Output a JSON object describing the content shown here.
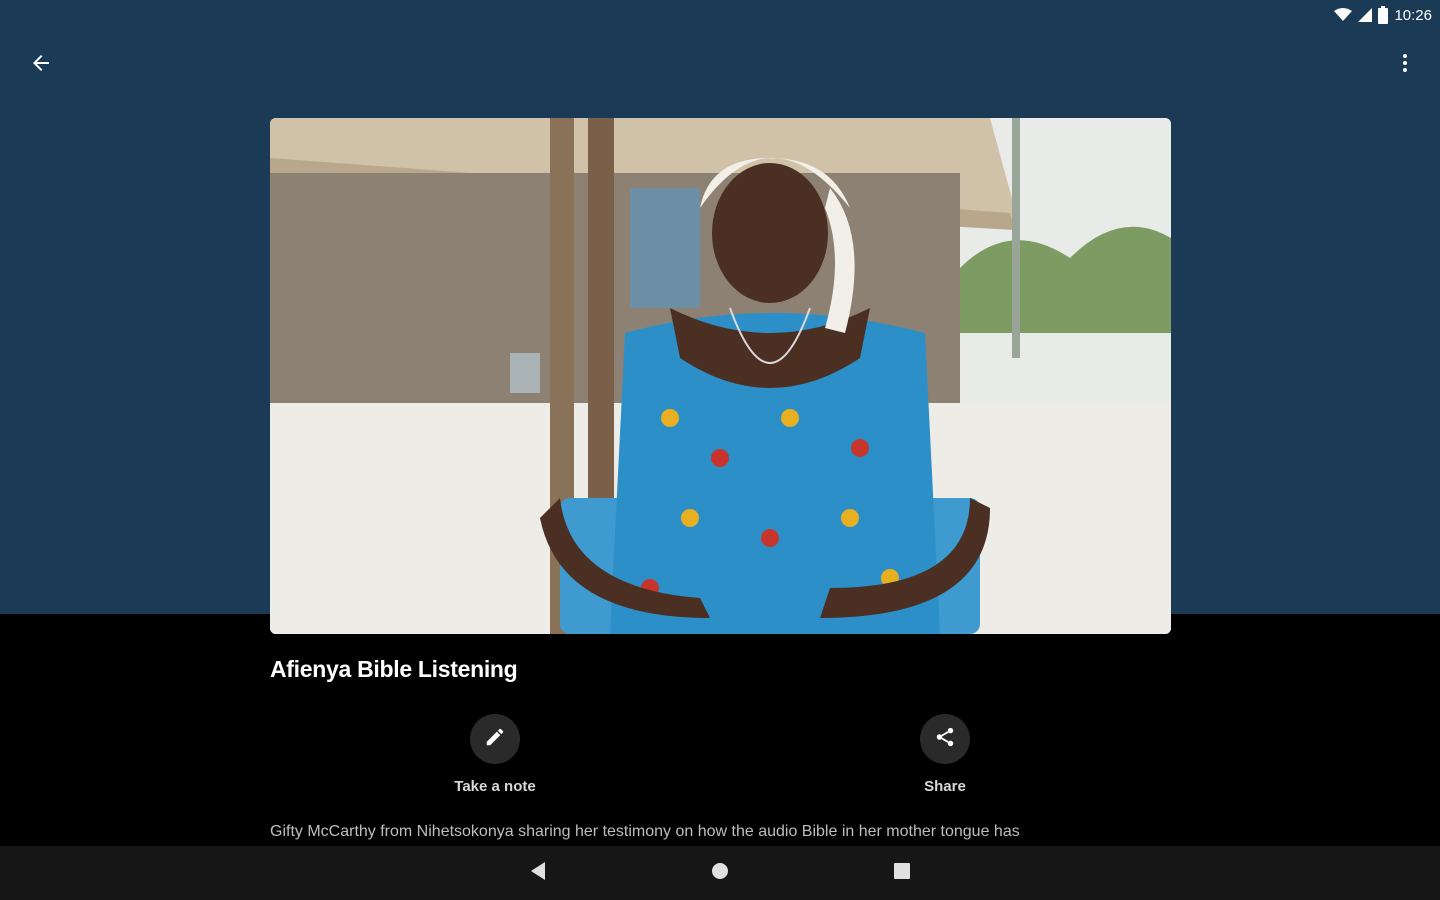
{
  "status_bar": {
    "time": "10:26",
    "icons": [
      "wifi-icon",
      "cell-signal-icon",
      "battery-icon"
    ]
  },
  "app_bar": {
    "back_icon": "arrow-back-icon",
    "more_icon": "more-vert-icon"
  },
  "video": {
    "title": "Afienya Bible Listening",
    "description": "Gifty McCarthy from Nihetsokonya sharing her testimony on how the audio Bible in her mother tongue has"
  },
  "actions": [
    {
      "label": "Take a note",
      "icon": "pencil-icon"
    },
    {
      "label": "Share",
      "icon": "share-icon"
    }
  ],
  "nav_bar": {
    "buttons": [
      "back-triangle-icon",
      "home-circle-icon",
      "recents-square-icon"
    ]
  },
  "colors": {
    "header_bg": "#1b3a55",
    "content_bg": "#000000",
    "nav_bg": "#161616"
  }
}
